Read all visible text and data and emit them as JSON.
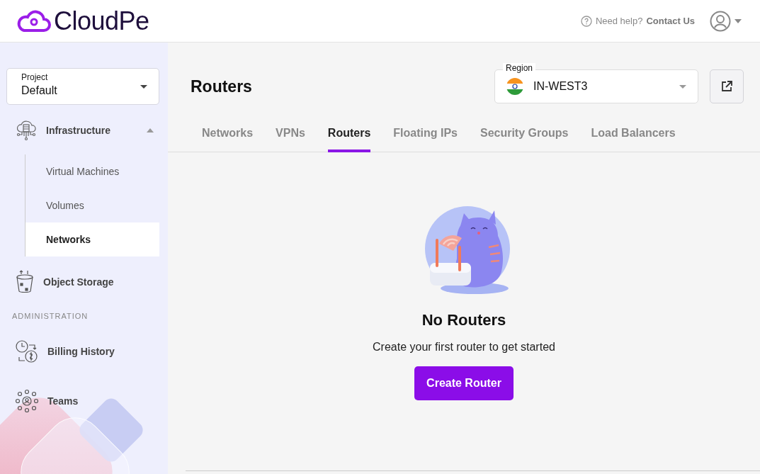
{
  "header": {
    "logo": "CloudPe",
    "help_text": "Need help?",
    "help_link": "Contact Us"
  },
  "sidebar": {
    "project": {
      "label": "Project",
      "value": "Default"
    },
    "items": [
      {
        "label": "Infrastructure",
        "kind": "infra",
        "expanded": true,
        "children": [
          {
            "label": "Virtual Machines",
            "selected": false
          },
          {
            "label": "Volumes",
            "selected": false
          },
          {
            "label": "Networks",
            "selected": true
          }
        ]
      },
      {
        "label": "Object Storage",
        "kind": "storage"
      }
    ],
    "section": "ADMINISTRATION",
    "admin_items": [
      {
        "label": "Billing History",
        "kind": "billing"
      },
      {
        "label": "Teams",
        "kind": "teams"
      }
    ]
  },
  "page": {
    "title": "Routers",
    "region": {
      "label": "Region",
      "value": "IN-WEST3"
    },
    "tabs": [
      {
        "label": "Networks",
        "selected": false
      },
      {
        "label": "VPNs",
        "selected": false
      },
      {
        "label": "Routers",
        "selected": true
      },
      {
        "label": "Floating IPs",
        "selected": false
      },
      {
        "label": "Security Groups",
        "selected": false
      },
      {
        "label": "Load Balancers",
        "selected": false
      }
    ],
    "empty": {
      "title": "No Routers",
      "text": "Create your first router to get started",
      "button": "Create Router"
    }
  }
}
